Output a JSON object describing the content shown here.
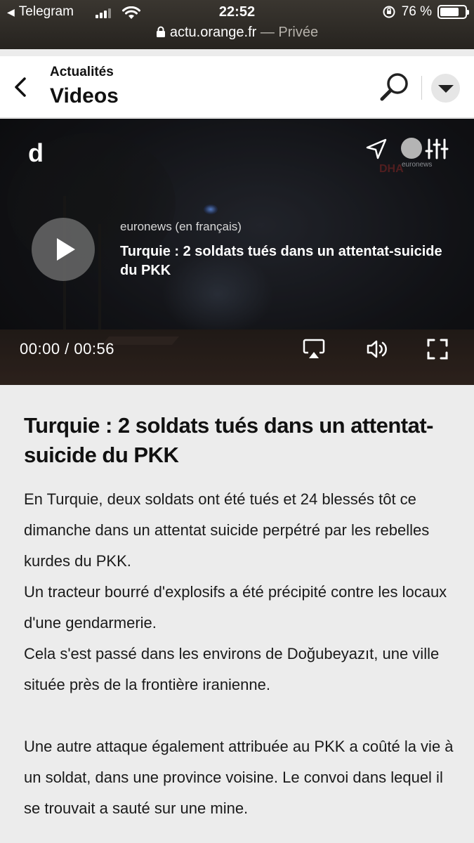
{
  "status_bar": {
    "back_app": "Telegram",
    "time": "22:52",
    "battery": "76 %",
    "battery_level": 0.76,
    "url": "actu.orange.fr",
    "url_suffix": " — Privée"
  },
  "header": {
    "breadcrumb": "Actualités",
    "title": "Videos"
  },
  "video": {
    "logo": "d",
    "watermark_brand": "euronews",
    "watermark_agency": "DHA",
    "source": "euronews (en français)",
    "title": "Turquie : 2 soldats tués dans un attentat-suicide du PKK",
    "time_current": "00:00",
    "time_total": "00:56",
    "time_display": "00:00 / 00:56"
  },
  "article": {
    "title": "Turquie : 2 soldats tués dans un attentat-suicide du PKK",
    "paragraphs": [
      "En Turquie, deux soldats ont été tués et 24 blessés tôt ce dimanche dans un attentat suicide perpétré par les rebelles kurdes du PKK.",
      "Un tracteur bourré d'explosifs a été précipité contre les locaux d'une gendarmerie.",
      "Cela s'est passé dans les environs de Doğubeyazıt, une ville située près de la frontière iranienne.",
      "Une autre attaque également attribuée au PKK a coûté la vie à un soldat, dans une province voisine. Le convoi dans lequel il se trouvait a sauté sur une mine."
    ]
  }
}
